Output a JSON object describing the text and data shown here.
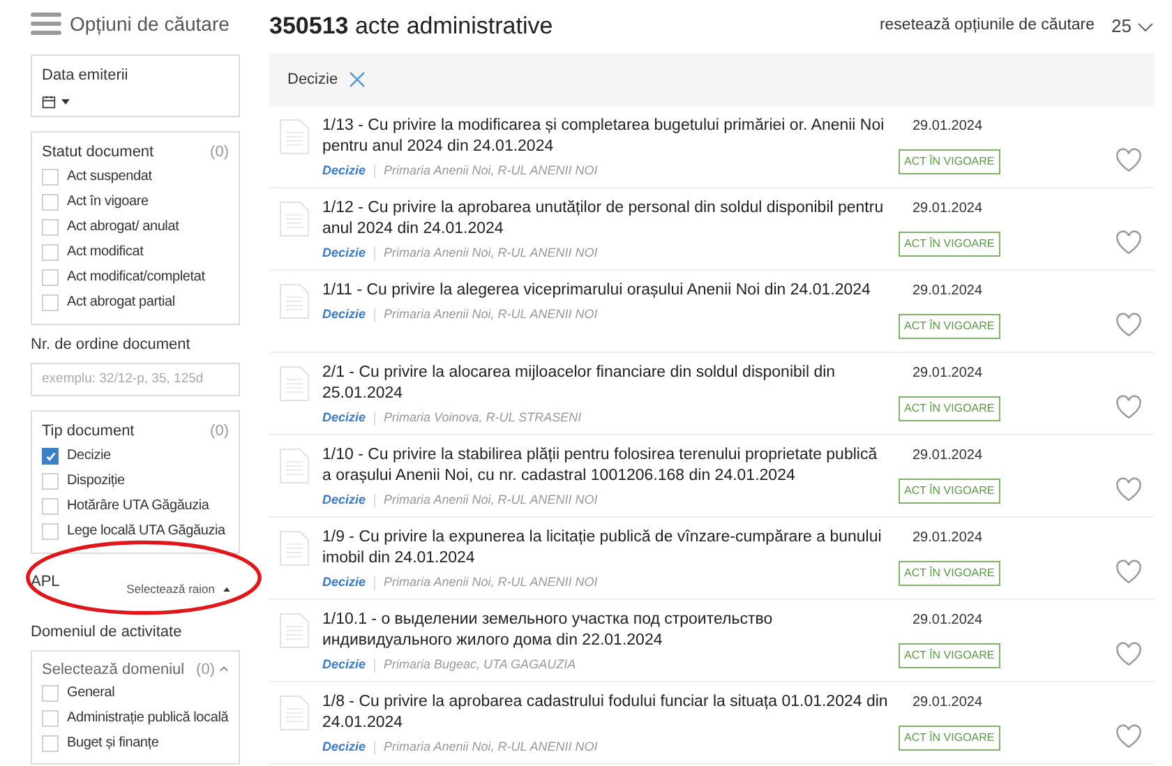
{
  "sidebar": {
    "title": "Opțiuni de căutare",
    "date_box": {
      "label": "Data emiterii"
    },
    "status_box": {
      "title": "Statut document",
      "count": "(0)",
      "items": [
        {
          "label": "Act suspendat",
          "checked": false
        },
        {
          "label": "Act în vigoare",
          "checked": false
        },
        {
          "label": "Act abrogat/ anulat",
          "checked": false
        },
        {
          "label": "Act modificat",
          "checked": false
        },
        {
          "label": "Act modificat/completat",
          "checked": false
        },
        {
          "label": "Act abrogat partial",
          "checked": false
        }
      ]
    },
    "order_field": {
      "label": "Nr. de ordine document",
      "placeholder": "exemplu: 32/12-p, 35, 125d"
    },
    "type_box": {
      "title": "Tip document",
      "count": "(0)",
      "items": [
        {
          "label": "Decizie",
          "checked": true
        },
        {
          "label": "Dispoziție",
          "checked": false
        },
        {
          "label": "Hotărâre UTA Găgăuzia",
          "checked": false
        },
        {
          "label": "Lege locală UTA Găgăuzia",
          "checked": false
        }
      ]
    },
    "apl": {
      "label": "APL",
      "select": "Selectează raion"
    },
    "domain": {
      "label": "Domeniul de activitate",
      "select": "Selectează domeniul",
      "count": "(0)",
      "items": [
        {
          "label": "General",
          "checked": false
        },
        {
          "label": "Administrație publică locală",
          "checked": false
        },
        {
          "label": "Buget și finanțe",
          "checked": false
        }
      ]
    }
  },
  "header": {
    "count": "350513",
    "title": "acte administrative",
    "reset": "resetează opțiunile de căutare",
    "page_size": "25"
  },
  "filters": [
    {
      "label": "Decizie"
    }
  ],
  "results": [
    {
      "title": "1/13 - Cu privire la modificarea și completarea bugetului primăriei or. Anenii Noi pentru anul 2024 din 24.01.2024",
      "type": "Decizie",
      "issuer": "Primaria Anenii Noi, R-UL ANENII NOI",
      "date": "29.01.2024",
      "status": "ACT ÎN VIGOARE"
    },
    {
      "title": "1/12 - Cu privire la aprobarea unutăților de personal din soldul disponibil pentru anul 2024 din 24.01.2024",
      "type": "Decizie",
      "issuer": "Primaria Anenii Noi, R-UL ANENII NOI",
      "date": "29.01.2024",
      "status": "ACT ÎN VIGOARE"
    },
    {
      "title": "1/11 - Cu privire la alegerea viceprimarului orașului Anenii Noi din 24.01.2024",
      "type": "Decizie",
      "issuer": "Primaria Anenii Noi, R-UL ANENII NOI",
      "date": "29.01.2024",
      "status": "ACT ÎN VIGOARE"
    },
    {
      "title": "2/1 - Cu privire la alocarea mijloacelor financiare din soldul disponibil din 25.01.2024",
      "type": "Decizie",
      "issuer": "Primaria Voinova, R-UL STRASENI",
      "date": "29.01.2024",
      "status": "ACT ÎN VIGOARE"
    },
    {
      "title": "1/10 - Cu privire la stabilirea plății pentru folosirea terenului proprietate publică a orașului Anenii Noi, cu nr. cadastral 1001206.168 din 24.01.2024",
      "type": "Decizie",
      "issuer": "Primaria Anenii Noi, R-UL ANENII NOI",
      "date": "29.01.2024",
      "status": "ACT ÎN VIGOARE"
    },
    {
      "title": "1/9 - Cu privire la expunerea la licitație publică de vînzare-cumpărare a bunului imobil din 24.01.2024",
      "type": "Decizie",
      "issuer": "Primaria Anenii Noi, R-UL ANENII NOI",
      "date": "29.01.2024",
      "status": "ACT ÎN VIGOARE"
    },
    {
      "title": "1/10.1 - о выделении земельного участка под строительство индивидуального жилого дома din 22.01.2024",
      "type": "Decizie",
      "issuer": "Primaria Bugeac, UTA GAGAUZIA",
      "date": "29.01.2024",
      "status": "ACT ÎN VIGOARE"
    },
    {
      "title": "1/8 - Cu privire la aprobarea cadastrului fodului funciar la situața 01.01.2024 din 24.01.2024",
      "type": "Decizie",
      "issuer": "Primaria Anenii Noi, R-UL ANENII NOI",
      "date": "29.01.2024",
      "status": "ACT ÎN VIGOARE"
    }
  ]
}
